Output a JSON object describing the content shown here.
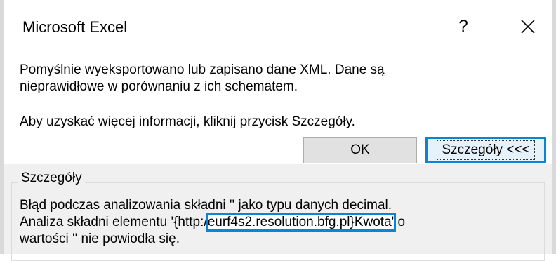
{
  "window": {
    "title": "Microsoft Excel",
    "help_label": "?"
  },
  "message": {
    "line1": "Pomyślnie wyeksportowano lub zapisano dane XML. Dane są",
    "line2": "nieprawidłowe w porównaniu z ich schematem.",
    "line3": "Aby uzyskać więcej informacji, kliknij przycisk Szczegóły."
  },
  "buttons": {
    "ok_label": "OK",
    "details_label": "Szczegóły <<<"
  },
  "details": {
    "legend": "Szczegóły",
    "line1": "Błąd podczas analizowania składni '' jako typu danych decimal.",
    "line2_prefix": "Analiza składni elementu '{http:/",
    "line2_highlight": "eurf4s2.resolution.bfg.pl}Kwota'",
    "line2_suffix": " o",
    "line3": "wartości '' nie powiodła się."
  },
  "colors": {
    "highlight": "#0a84d6",
    "dialog_bg": "#f0f0f0"
  }
}
